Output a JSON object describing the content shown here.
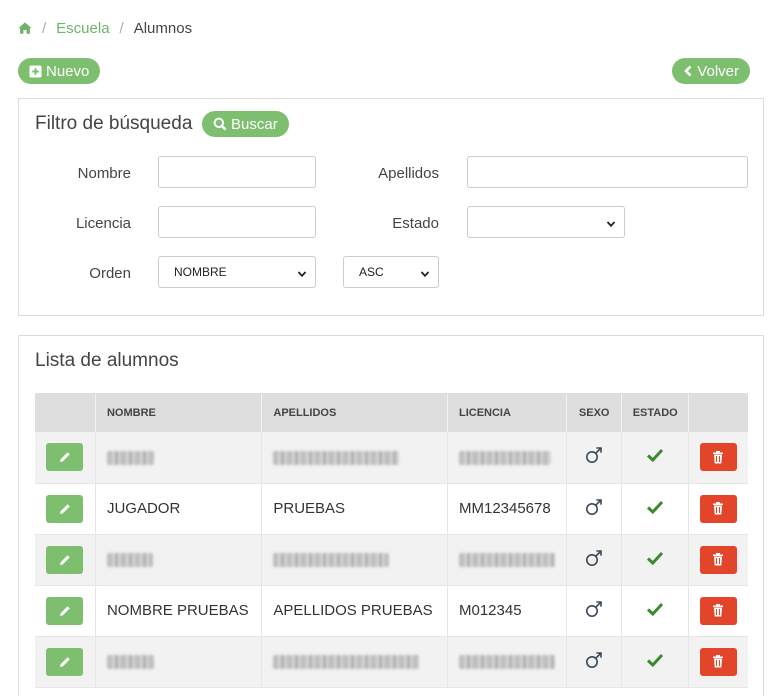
{
  "breadcrumb": {
    "home_icon": "home-icon",
    "items": [
      "Escuela",
      "Alumnos"
    ]
  },
  "toolbar": {
    "new_label": "Nuevo",
    "back_label": "Volver"
  },
  "filter": {
    "title": "Filtro de búsqueda",
    "search_label": "Buscar",
    "nombre_label": "Nombre",
    "apellidos_label": "Apellidos",
    "licencia_label": "Licencia",
    "estado_label": "Estado",
    "orden_label": "Orden",
    "nombre_value": "",
    "apellidos_value": "",
    "licencia_value": "",
    "estado_value": "",
    "orden_value": "NOMBRE",
    "direccion_value": "ASC"
  },
  "list": {
    "title": "Lista de alumnos",
    "columns": [
      "",
      "NOMBRE",
      "APELLIDOS",
      "LICENCIA",
      "SEXO",
      "ESTADO",
      ""
    ],
    "rows": [
      {
        "nombre": "",
        "apellidos": "",
        "licencia": "",
        "redacted": true,
        "sexo": "male",
        "estado": "active"
      },
      {
        "nombre": "JUGADOR",
        "apellidos": "PRUEBAS",
        "licencia": "MM12345678",
        "redacted": false,
        "sexo": "male",
        "estado": "active"
      },
      {
        "nombre": "",
        "apellidos": "",
        "licencia": "",
        "redacted": true,
        "sexo": "male",
        "estado": "active"
      },
      {
        "nombre": "NOMBRE PRUEBAS",
        "apellidos": "APELLIDOS PRUEBAS",
        "licencia": "M012345",
        "redacted": false,
        "sexo": "male",
        "estado": "active"
      },
      {
        "nombre": "",
        "apellidos": "",
        "licencia": "",
        "redacted": true,
        "sexo": "male",
        "estado": "active"
      }
    ]
  },
  "colors": {
    "accent": "#7dbf6e",
    "danger": "#e2452a",
    "check": "#3c8a2e",
    "male_icon": "#3a4a5a"
  }
}
